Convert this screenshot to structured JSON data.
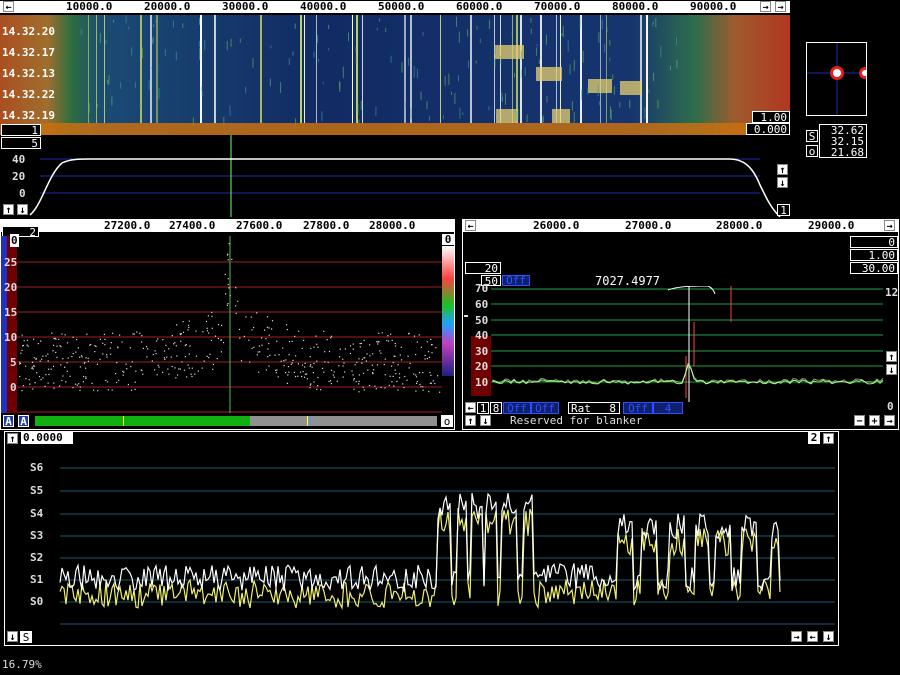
{
  "waterfall": {
    "freq_ticks": [
      "10000.0",
      "20000.0",
      "30000.0",
      "40000.0",
      "50000.0",
      "60000.0",
      "70000.0",
      "80000.0",
      "90000.0"
    ],
    "time_labels": [
      "14.32.20",
      "14.32.17",
      "14.32.13",
      "14.32.22",
      "14.32.19"
    ],
    "left_box": "1",
    "right_top_box": "1.00",
    "right_bottom_box": "0.000"
  },
  "spectrum": {
    "left_box": "5",
    "y_ticks": [
      "40",
      "20",
      "0"
    ],
    "right_box": "1"
  },
  "smeter_panel": {
    "s_label": "S",
    "o_label": "o",
    "values": [
      "32.62",
      "32.15",
      "21.68"
    ]
  },
  "baseband": {
    "box_label": "2",
    "freq_ticks": [
      "27200.0",
      "27400.0",
      "27600.0",
      "27800.0",
      "28000.0"
    ],
    "y_ticks": [
      "0",
      "25",
      "20",
      "15",
      "10",
      "5",
      "0"
    ],
    "right_top_box": "0",
    "bottom_left_a1": "A",
    "bottom_left_a2": "A",
    "bottom_right_o": "o"
  },
  "hires": {
    "freq_ticks": [
      "26000.0",
      "27000.0",
      "28000.0",
      "29000.0"
    ],
    "box_20": "20",
    "box_1_00": "1.00",
    "box_30_00": "30.00",
    "box_0": "0",
    "box_50": "50",
    "off_label": "Off",
    "center_freq": "7027.4977",
    "y_ticks": [
      "70",
      "60",
      "50",
      "40",
      "30",
      "20",
      "10"
    ],
    "right_ticks": [
      "12",
      "0"
    ],
    "bottom": {
      "box_1": "1",
      "box_8": "8",
      "off1": "Off",
      "off2": "Off",
      "rat_label": "Rat",
      "rat_value": "8",
      "off3": "Off",
      "val_4": "4"
    },
    "blanker_text": "Reserved for blanker"
  },
  "meter_graph": {
    "value_box": "0.0000",
    "right_box": "2",
    "s_ticks": [
      "S6",
      "S5",
      "S4",
      "S3",
      "S2",
      "S1",
      "S0"
    ],
    "bottom_s": "S"
  },
  "status": {
    "percent": "16.79%"
  }
}
